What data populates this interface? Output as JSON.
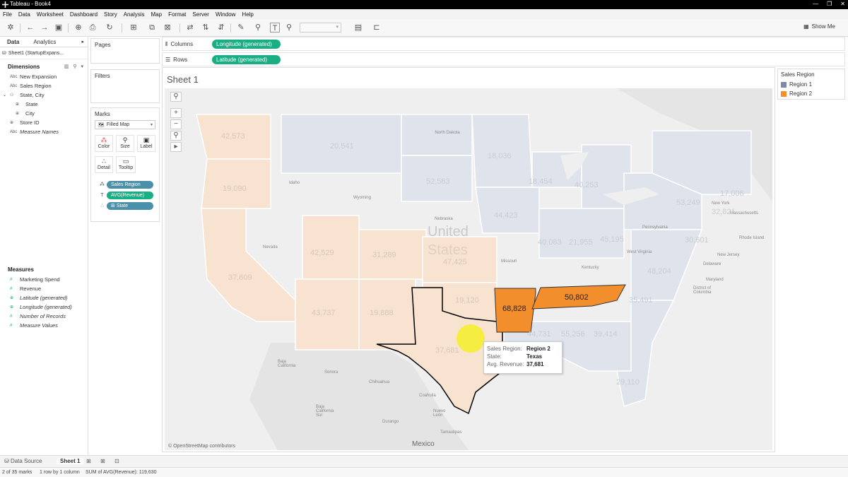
{
  "window": {
    "title": "Tableau - Book4"
  },
  "menu": [
    "File",
    "Data",
    "Worksheet",
    "Dashboard",
    "Story",
    "Analysis",
    "Map",
    "Format",
    "Server",
    "Window",
    "Help"
  ],
  "toolbar": {
    "show_me": "Show Me"
  },
  "data_pane": {
    "tabs": [
      "Data",
      "Analytics"
    ],
    "datasource": "Sheet1 (StartupExpans...",
    "dimensions_title": "Dimensions",
    "dimensions": [
      {
        "label": "New Expansion",
        "type": "Abc"
      },
      {
        "label": "Sales Region",
        "type": "Abc"
      },
      {
        "label": "State, City",
        "type": "hierarchy"
      },
      {
        "label": "State",
        "type": "geo"
      },
      {
        "label": "City",
        "type": "geo"
      },
      {
        "label": "Store ID",
        "type": "geo"
      },
      {
        "label": "Measure Names",
        "type": "Abc"
      }
    ],
    "measures_title": "Measures",
    "measures": [
      {
        "label": "Marketing Spend",
        "type": "#"
      },
      {
        "label": "Revenue",
        "type": "#"
      },
      {
        "label": "Latitude (generated)",
        "type": "geo"
      },
      {
        "label": "Longitude (generated)",
        "type": "geo"
      },
      {
        "label": "Number of Records",
        "type": "#"
      },
      {
        "label": "Measure Values",
        "type": "#"
      }
    ]
  },
  "cards": {
    "pages": "Pages",
    "filters": "Filters",
    "marks": "Marks",
    "mark_type": "Filled Map",
    "mark_buttons": [
      "Color",
      "Size",
      "Label",
      "Detail",
      "Tooltip"
    ],
    "mark_pills": [
      "Sales Region",
      "AVG(Revenue)",
      "State"
    ]
  },
  "shelves": {
    "columns_label": "Columns",
    "columns_pill": "Longitude (generated)",
    "rows_label": "Rows",
    "rows_pill": "Latitude (generated)"
  },
  "sheet": {
    "title": "Sheet 1"
  },
  "map": {
    "country_label": "United",
    "country_label2": "States",
    "attribution": "© OpenStreetMap contributors",
    "places": [
      "North Dakota",
      "Idaho",
      "Wyoming",
      "Nebraska",
      "Nevada",
      "Missouri",
      "Kentucky",
      "West Virginia",
      "Pennsylvania",
      "New York",
      "Massachusetts",
      "Rhode Island",
      "New Jersey",
      "Delaware",
      "Maryland",
      "District of Columbia",
      "Baja California",
      "Sonora",
      "Chihuahua",
      "Baja California Sur",
      "Durango",
      "Coahuila",
      "Nuevo León",
      "Tamaulipas",
      "Mexico"
    ],
    "state_values": [
      "42,573",
      "20,541",
      "18,036",
      "19,090",
      "52,583",
      "18,454",
      "40,253",
      "44,423",
      "53,249",
      "32,821",
      "17,006",
      "42,529",
      "31,289",
      "47,425",
      "40,083",
      "21,955",
      "45,195",
      "30,601",
      "37,609",
      "19,120",
      "48,204",
      "43,737",
      "19,888",
      "44,731",
      "55,256",
      "39,414",
      "35,491",
      "37,681",
      "29,110"
    ],
    "highlight_values": [
      "68,828",
      "50,802"
    ]
  },
  "tooltip": {
    "rows": [
      {
        "k": "Sales Region:",
        "v": "Region 2"
      },
      {
        "k": "State:",
        "v": "Texas"
      },
      {
        "k": "Avg. Revenue:",
        "v": "37,681"
      }
    ]
  },
  "legend": {
    "title": "Sales Region",
    "items": [
      {
        "label": "Region 1",
        "color": "#7b8aa8"
      },
      {
        "label": "Region 2",
        "color": "#f28e2b"
      }
    ]
  },
  "colors": {
    "region1_fill": "#dfe4ec",
    "region2_fill": "#f7e3cf",
    "highlight": "#f28e2b",
    "pill_blue": "#4a90a8",
    "pill_green": "#1aae85"
  },
  "sheet_tabs": {
    "data_source": "Data Source",
    "sheet1": "Sheet 1"
  },
  "status": {
    "marks": "2 of 35 marks",
    "rows": "1 row by 1 column",
    "sum": "SUM of AVG(Revenue): 119,630"
  }
}
